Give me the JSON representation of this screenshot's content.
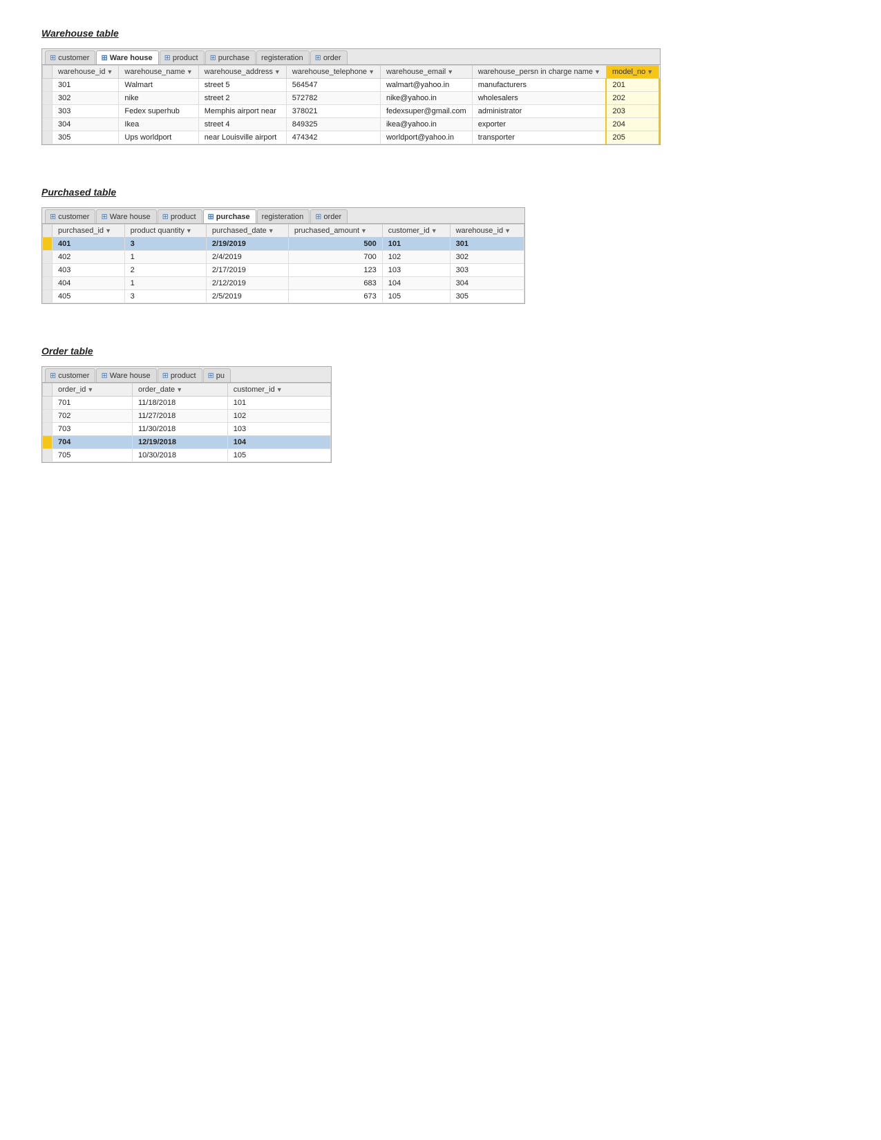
{
  "warehouse": {
    "title": "Warehouse table",
    "tabs": [
      {
        "label": "customer",
        "active": false
      },
      {
        "label": "Ware house",
        "active": true
      },
      {
        "label": "product",
        "active": false
      },
      {
        "label": "purchase",
        "active": false
      },
      {
        "label": "registeration",
        "active": false
      },
      {
        "label": "order",
        "active": false
      }
    ],
    "columns": [
      {
        "label": "warehouse_id",
        "sortable": true
      },
      {
        "label": "warehouse_name",
        "sortable": true
      },
      {
        "label": "warehouse_address",
        "sortable": true
      },
      {
        "label": "warehouse_telephone",
        "sortable": true
      },
      {
        "label": "warehouse_email",
        "sortable": true
      },
      {
        "label": "warehouse_persn in charge name",
        "sortable": true
      },
      {
        "label": "model_no",
        "sortable": true,
        "highlighted": true
      }
    ],
    "rows": [
      {
        "cells": [
          "301",
          "Walmart",
          "street 5",
          "564547",
          "walmart@yahoo.in",
          "manufacturers",
          "201"
        ],
        "highlighted": false
      },
      {
        "cells": [
          "302",
          "nike",
          "street 2",
          "572782",
          "nike@yahoo.in",
          "wholesalers",
          "202"
        ],
        "highlighted": false
      },
      {
        "cells": [
          "303",
          "Fedex superhub",
          "Memphis airport near",
          "378021",
          "fedexsuper@gmail.com",
          "administrator",
          "203"
        ],
        "highlighted": false
      },
      {
        "cells": [
          "304",
          "Ikea",
          "street 4",
          "849325",
          "ikea@yahoo.in",
          "exporter",
          "204"
        ],
        "highlighted": false
      },
      {
        "cells": [
          "305",
          "Ups worldport",
          "near Louisville airport",
          "474342",
          "worldport@yahoo.in",
          "transporter",
          "205"
        ],
        "highlighted": false
      }
    ]
  },
  "purchase": {
    "title": "Purchased table",
    "tabs": [
      {
        "label": "customer",
        "active": false
      },
      {
        "label": "Ware house",
        "active": false
      },
      {
        "label": "product",
        "active": false
      },
      {
        "label": "purchase",
        "active": true
      },
      {
        "label": "registeration",
        "active": false
      },
      {
        "label": "order",
        "active": false
      }
    ],
    "columns": [
      {
        "label": "purchased_id",
        "sortable": true
      },
      {
        "label": "product quantity",
        "sortable": true
      },
      {
        "label": "purchased_date",
        "sortable": true
      },
      {
        "label": "pruchased_amount",
        "sortable": true
      },
      {
        "label": "customer_id",
        "sortable": true
      },
      {
        "label": "warehouse_id",
        "sortable": true
      }
    ],
    "rows": [
      {
        "cells": [
          "401",
          "3",
          "2/19/2019",
          "500",
          "101",
          "301"
        ],
        "highlighted": true
      },
      {
        "cells": [
          "402",
          "1",
          "2/4/2019",
          "700",
          "102",
          "302"
        ],
        "highlighted": false
      },
      {
        "cells": [
          "403",
          "2",
          "2/17/2019",
          "123",
          "103",
          "303"
        ],
        "highlighted": false
      },
      {
        "cells": [
          "404",
          "1",
          "2/12/2019",
          "683",
          "104",
          "304"
        ],
        "highlighted": false
      },
      {
        "cells": [
          "405",
          "3",
          "2/5/2019",
          "673",
          "105",
          "305"
        ],
        "highlighted": false
      }
    ]
  },
  "order": {
    "title": "Order table",
    "tabs": [
      {
        "label": "customer",
        "active": false
      },
      {
        "label": "Ware house",
        "active": false
      },
      {
        "label": "product",
        "active": false
      },
      {
        "label": "pu",
        "active": false
      }
    ],
    "columns": [
      {
        "label": "order_id",
        "sortable": true
      },
      {
        "label": "order_date",
        "sortable": true
      },
      {
        "label": "customer_id",
        "sortable": true
      }
    ],
    "rows": [
      {
        "cells": [
          "701",
          "11/18/2018",
          "101"
        ],
        "highlighted": false
      },
      {
        "cells": [
          "702",
          "11/27/2018",
          "102"
        ],
        "highlighted": false
      },
      {
        "cells": [
          "703",
          "11/30/2018",
          "103"
        ],
        "highlighted": false
      },
      {
        "cells": [
          "704",
          "12/19/2018",
          "104"
        ],
        "highlighted": true
      },
      {
        "cells": [
          "705",
          "10/30/2018",
          "105"
        ],
        "highlighted": false
      }
    ]
  }
}
